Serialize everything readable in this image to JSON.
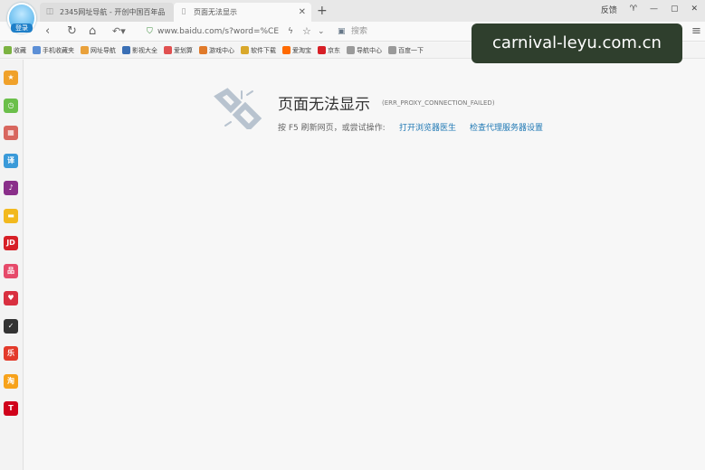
{
  "logo": {
    "label": "登录"
  },
  "tabs": [
    {
      "label": "2345网址导航 - 开创中国百年品"
    },
    {
      "label": "页面无法显示"
    }
  ],
  "window_buttons": {
    "feedback": "反馈"
  },
  "address": {
    "url": "www.baidu.com/s?word=%CE"
  },
  "search": {
    "placeholder": "搜索"
  },
  "bookmarks": [
    {
      "label": "收藏",
      "icon": "star-icon",
      "color": "#7cb342"
    },
    {
      "label": "手机收藏夹",
      "icon": "phone-icon",
      "color": "#5c8fd6"
    },
    {
      "label": "网址导航",
      "icon": "home-icon",
      "color": "#e9a13b"
    },
    {
      "label": "影视大全",
      "icon": "film-icon",
      "color": "#3a6fb5"
    },
    {
      "label": "爱划算",
      "icon": "tag-icon",
      "color": "#e05050"
    },
    {
      "label": "游戏中心",
      "icon": "game-icon",
      "color": "#e07a2a"
    },
    {
      "label": "软件下载",
      "icon": "download-icon",
      "color": "#d9a82b"
    },
    {
      "label": "爱淘宝",
      "icon": "taobao-icon",
      "color": "#ff6a00"
    },
    {
      "label": "京东",
      "icon": "jd-icon",
      "color": "#d71f26"
    },
    {
      "label": "导航中心",
      "icon": "page-icon",
      "color": "#9a9a9a"
    },
    {
      "label": "百度一下",
      "icon": "page-icon",
      "color": "#9a9a9a"
    }
  ],
  "watermark": "carnival-leyu.com.cn",
  "sidebar": [
    {
      "name": "favorites-icon",
      "glyph": "★",
      "color": "#f0a12a"
    },
    {
      "name": "history-icon",
      "glyph": "◷",
      "color": "#6bbf4a"
    },
    {
      "name": "calendar-icon",
      "glyph": "▦",
      "color": "#d8665e"
    },
    {
      "name": "translate-icon",
      "glyph": "译",
      "color": "#3a9ad9"
    },
    {
      "name": "music-icon",
      "glyph": "♪",
      "color": "#8a2f8a"
    },
    {
      "name": "note-icon",
      "glyph": "▬",
      "color": "#f2b91e"
    },
    {
      "name": "jd-icon",
      "glyph": "JD",
      "color": "#d71f26"
    },
    {
      "name": "gift-icon",
      "glyph": "品",
      "color": "#e64a6a"
    },
    {
      "name": "heart-icon",
      "glyph": "♥",
      "color": "#d93040"
    },
    {
      "name": "nike-icon",
      "glyph": "✓",
      "color": "#333333"
    },
    {
      "name": "shop-icon",
      "glyph": "乐",
      "color": "#e33a2a"
    },
    {
      "name": "taobao-icon",
      "glyph": "淘",
      "color": "#f7a21b"
    },
    {
      "name": "tmall-icon",
      "glyph": "T",
      "color": "#d0021b"
    }
  ],
  "error": {
    "title": "页面无法显示",
    "code": "(ERR_PROXY_CONNECTION_FAILED)",
    "hint": "按 F5 刷新网页，或尝试操作:",
    "link1": "打开浏览器医生",
    "link2": "检查代理服务器设置"
  }
}
